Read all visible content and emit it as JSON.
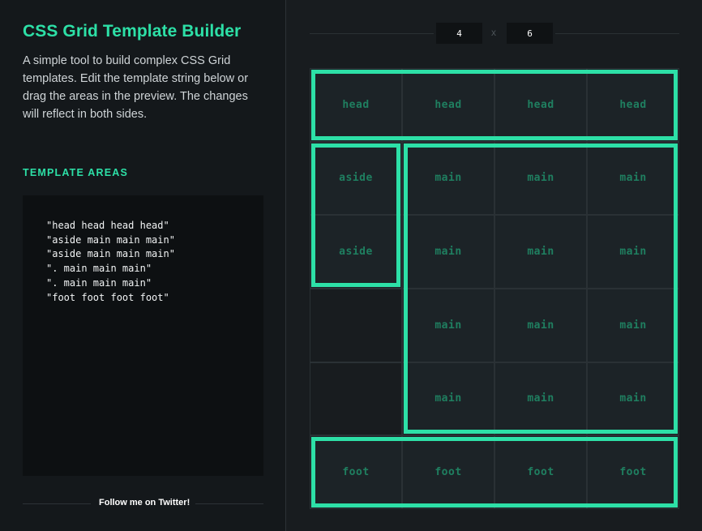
{
  "sidebar": {
    "title": "CSS Grid Template Builder",
    "description": "A simple tool to build complex CSS Grid templates. Edit the template string below or drag the areas in the preview. The changes will reflect in both sides.",
    "section_title": "TEMPLATE AREAS",
    "template_lines": [
      "\"head head head head\"",
      "\"aside main main main\"",
      "\"aside main main main\"",
      "\". main main main\"",
      "\". main main main\"",
      "\"foot foot foot foot\""
    ],
    "twitter_link": "Follow me on Twitter!"
  },
  "controls": {
    "columns": "4",
    "rows": "6",
    "separator": "x"
  },
  "grid": {
    "cells": [
      [
        "head",
        "head",
        "head",
        "head"
      ],
      [
        "aside",
        "main",
        "main",
        "main"
      ],
      [
        "aside",
        "main",
        "main",
        "main"
      ],
      [
        "",
        "main",
        "main",
        "main"
      ],
      [
        "",
        "main",
        "main",
        "main"
      ],
      [
        "foot",
        "foot",
        "foot",
        "foot"
      ]
    ],
    "areas": [
      "head",
      "aside",
      "main",
      "foot"
    ]
  },
  "colors": {
    "accent": "#2de0a7",
    "sidebar_bg": "#14181b",
    "editor_bg": "#0d1012",
    "main_bg": "#181c1f"
  }
}
